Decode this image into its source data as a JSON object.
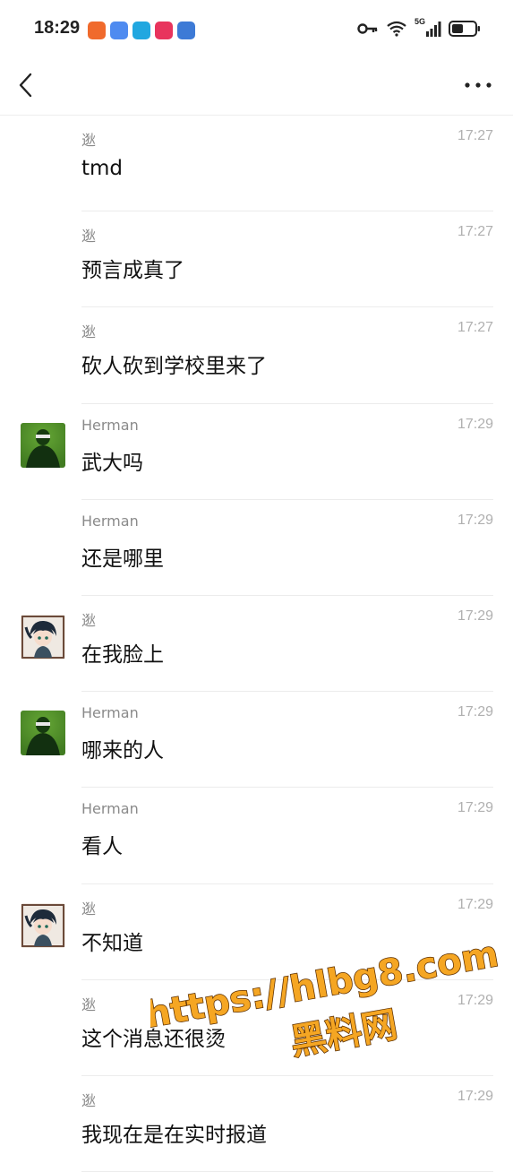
{
  "status_bar": {
    "time": "18:29",
    "network": "5G",
    "app_icons": [
      {
        "name": "app-icon-orange",
        "color": "#f06a2c"
      },
      {
        "name": "app-icon-blue",
        "color": "#4f8bf0"
      },
      {
        "name": "app-icon-teal",
        "color": "#21a7e0"
      },
      {
        "name": "app-icon-pink",
        "color": "#e8345d"
      },
      {
        "name": "app-icon-navy",
        "color": "#3d7ad6"
      }
    ]
  },
  "header": {
    "back_icon": "chevron-left-icon",
    "more_icon": "more-dots-icon"
  },
  "messages": [
    {
      "sender": "逖",
      "time": "17:27",
      "text": "tmd",
      "avatar": null
    },
    {
      "sender": "逖",
      "time": "17:27",
      "text": "预言成真了",
      "avatar": null
    },
    {
      "sender": "逖",
      "time": "17:27",
      "text": "砍人砍到学校里来了",
      "avatar": null
    },
    {
      "sender": "Herman",
      "time": "17:29",
      "text": "武大吗",
      "avatar": "green"
    },
    {
      "sender": "Herman",
      "time": "17:29",
      "text": "还是哪里",
      "avatar": null
    },
    {
      "sender": "逖",
      "time": "17:29",
      "text": "在我脸上",
      "avatar": "anime"
    },
    {
      "sender": "Herman",
      "time": "17:29",
      "text": "哪来的人",
      "avatar": "green"
    },
    {
      "sender": "Herman",
      "time": "17:29",
      "text": "看人",
      "avatar": null
    },
    {
      "sender": "逖",
      "time": "17:29",
      "text": "不知道",
      "avatar": "anime"
    },
    {
      "sender": "逖",
      "time": "17:29",
      "text": "这个消息还很烫",
      "avatar": null
    },
    {
      "sender": "逖",
      "time": "17:29",
      "text": "我现在是在实时报道",
      "avatar": null
    }
  ],
  "watermark": {
    "line1": "https://hlbg8.com",
    "line2": "黑料网",
    "color": "#f5a623"
  }
}
